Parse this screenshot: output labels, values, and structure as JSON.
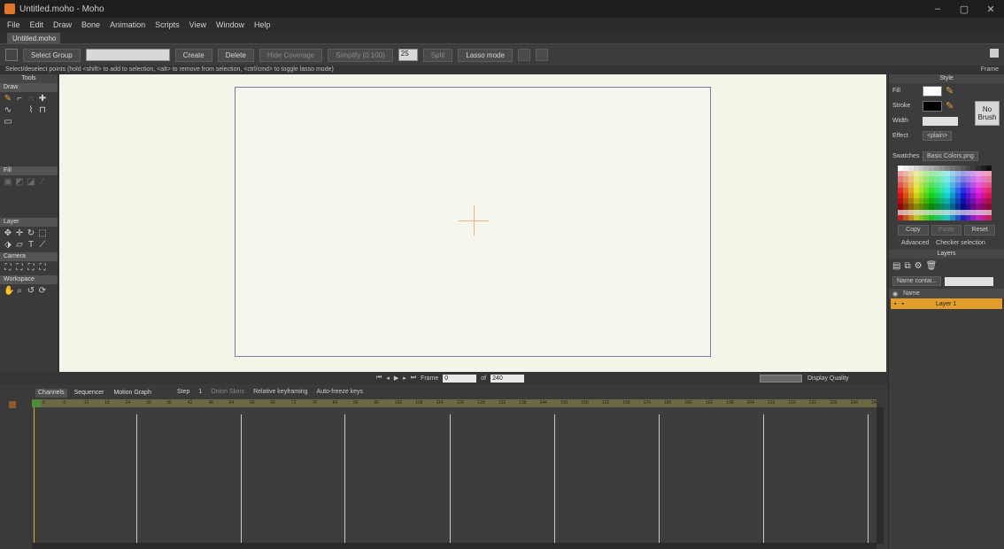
{
  "window": {
    "title": "Untitled.moho - Moho",
    "controls": [
      "–",
      "▢",
      "✕"
    ]
  },
  "menu": [
    "File",
    "Edit",
    "Draw",
    "Bone",
    "Animation",
    "Scripts",
    "View",
    "Window",
    "Help"
  ],
  "doc_tab": "Untitled.moho",
  "toolbar": {
    "select_group": "Select Group",
    "create": "Create",
    "delete": "Delete",
    "hide_coverage": "Hide Coverage",
    "simplify": "Simplify (0.100)",
    "spin_value": "25",
    "split": "Split",
    "lasso_mode": "Lasso mode"
  },
  "status": {
    "hint": "Select/deselect points (hold <shift> to add to selection, <alt> to remove from selection, <ctrl/cmd> to toggle lasso mode)",
    "frame_label": "Frame"
  },
  "tools": {
    "header": "Tools",
    "draw": "Draw",
    "fill": "Fill",
    "layer": "Layer",
    "camera": "Camera",
    "workspace": "Workspace"
  },
  "style": {
    "header": "Style",
    "fill": "Fill",
    "stroke": "Stroke",
    "width": "Width",
    "effect": "Effect",
    "effect_value": "<plain>",
    "no_brush": "No Brush",
    "swatches": "Swatches",
    "palette_file": "Basic Colors.png",
    "copy": "Copy",
    "paste": "Paste",
    "reset": "Reset",
    "advanced": "Advanced",
    "checker": "Checker selection",
    "fill_color": "#ffffff",
    "stroke_color": "#000000"
  },
  "layers": {
    "header": "Layers",
    "filter": "Name contai...",
    "name_col": "Name",
    "layer1": "Layer 1",
    "accent": "#e29d2a"
  },
  "playback": {
    "frame_label": "Frame",
    "frame_value": "0",
    "of_label": "of",
    "end_value": "240"
  },
  "display": {
    "quality": "Display Quality"
  },
  "timeline": {
    "tabs": [
      "Channels",
      "Sequencer",
      "Motion Graph"
    ],
    "step": "Step",
    "step_value": "1",
    "onion": "Onion Skins",
    "relative": "Relative keyframing",
    "auto_freeze": "Auto-freeze keys",
    "ruler": [
      "0",
      "6",
      "12",
      "18",
      "24",
      "30",
      "36",
      "42",
      "48",
      "54",
      "60",
      "66",
      "72",
      "78",
      "84",
      "90",
      "96",
      "102",
      "108",
      "114",
      "120",
      "126",
      "132",
      "138",
      "144",
      "150",
      "156",
      "162",
      "168",
      "174",
      "180",
      "186",
      "192",
      "198",
      "204",
      "210",
      "216",
      "222",
      "228",
      "234",
      "240"
    ]
  }
}
